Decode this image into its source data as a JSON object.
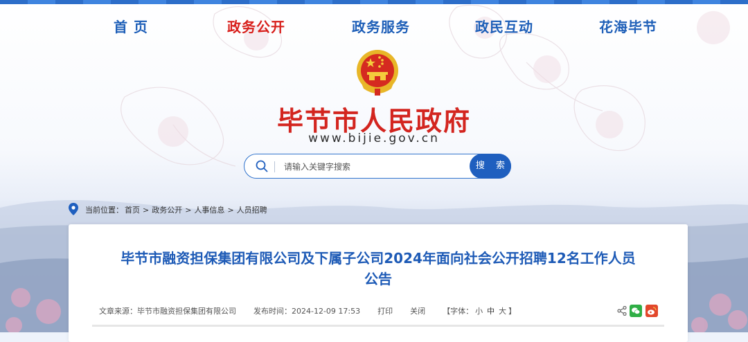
{
  "nav": {
    "items": [
      {
        "label": "首 页",
        "active": false
      },
      {
        "label": "政务公开",
        "active": true
      },
      {
        "label": "政务服务",
        "active": false
      },
      {
        "label": "政民互动",
        "active": false
      },
      {
        "label": "花海毕节",
        "active": false
      }
    ]
  },
  "header": {
    "site_title": "毕节市人民政府",
    "site_url": "www.bijie.gov.cn"
  },
  "search": {
    "placeholder": "请输入关键字搜索",
    "button_label": "搜 索"
  },
  "breadcrumb": {
    "label": "当前位置：",
    "items": [
      "首页",
      "政务公开",
      "人事信息",
      "人员招聘"
    ],
    "separator": ">"
  },
  "article": {
    "title_line1": "毕节市融资担保集团有限公司及下属子公司2024年面向社会公开招聘12名工作人员",
    "title_line2": "公告",
    "source_label": "文章来源：",
    "source": "毕节市融资担保集团有限公司",
    "date_label": "发布时间：",
    "date": "2024-12-09 17:53",
    "print_label": "打印",
    "close_label": "关闭",
    "font_label_open": "【字体：",
    "font_small": "小",
    "font_medium": "中",
    "font_large": "大",
    "font_label_close": "】"
  },
  "colors": {
    "nav_blue": "#1e5fb8",
    "nav_active_red": "#d8201c",
    "title_red": "#d3251f",
    "title_blue": "#1d5ab6",
    "button_blue": "#1f5fbf"
  },
  "icons": {
    "emblem": "national-emblem-icon",
    "search": "search-icon",
    "location": "location-pin-icon",
    "share": "share-icon",
    "wechat": "wechat-icon",
    "weibo": "weibo-icon"
  }
}
